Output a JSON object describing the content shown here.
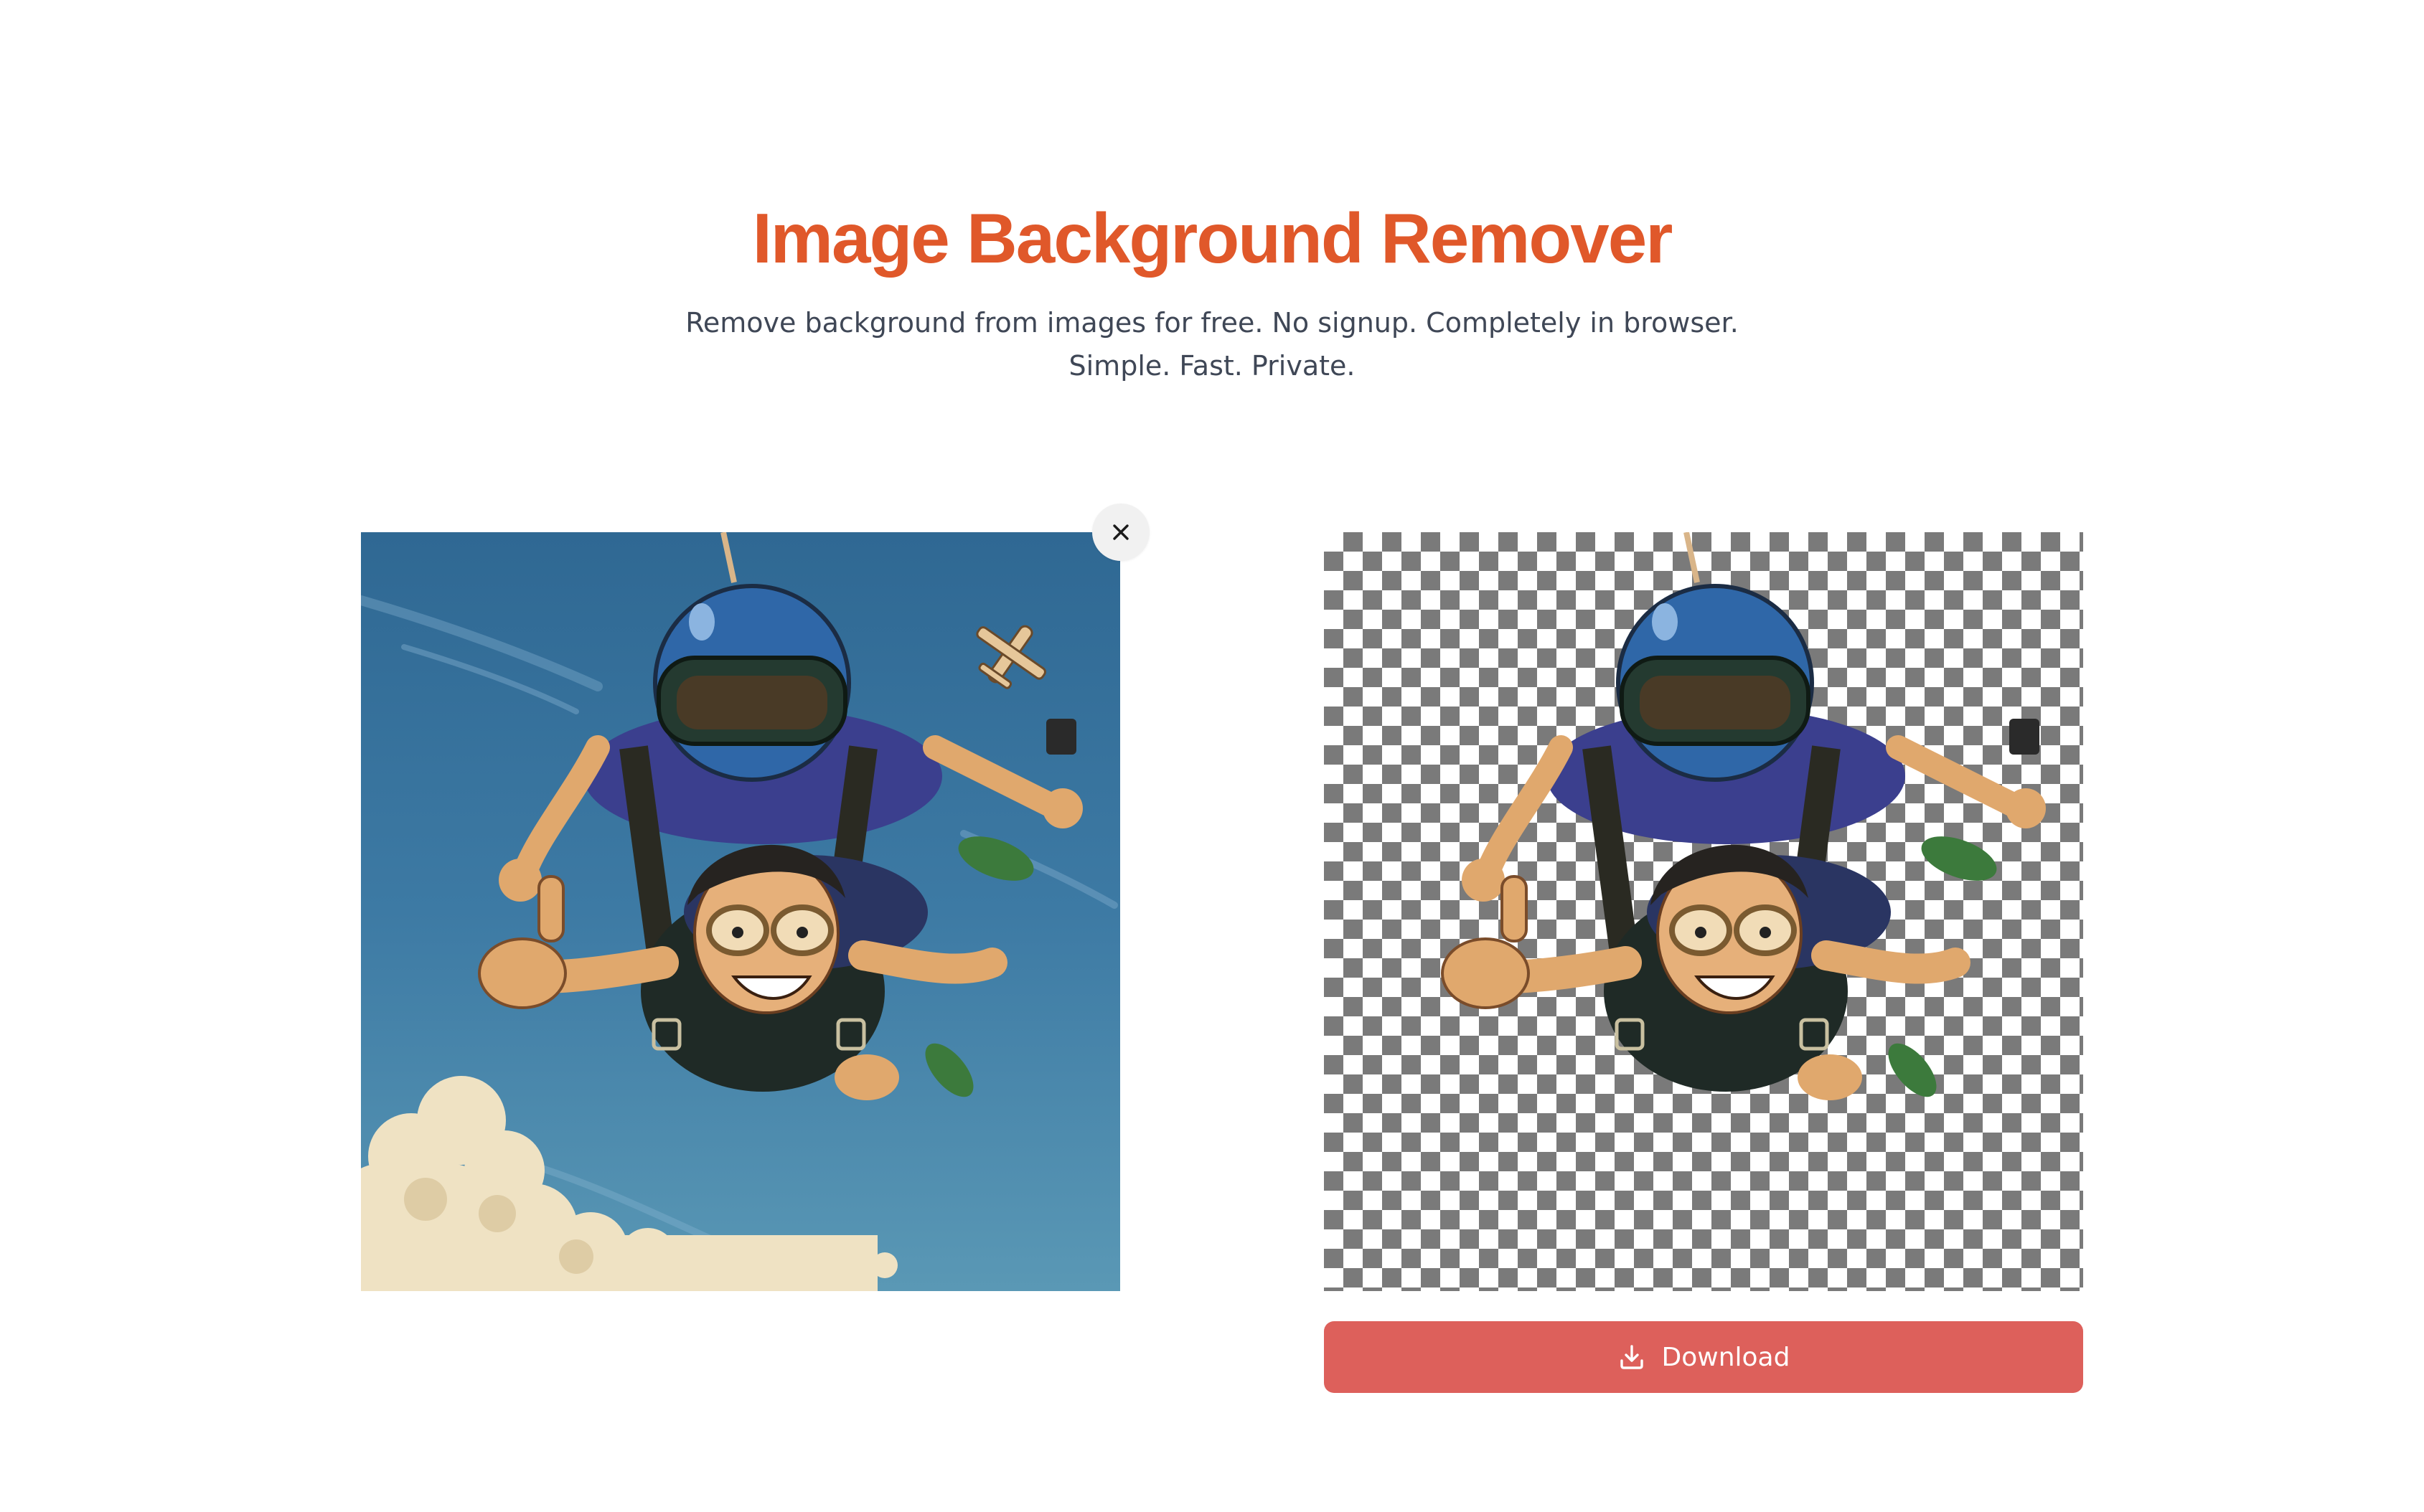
{
  "header": {
    "title": "Image Background Remover",
    "subtitle_line1": "Remove background from images for free. No signup. Completely in browser.",
    "subtitle_line2": "Simple. Fast. Private."
  },
  "original_panel": {
    "image_alt": "Cartoon illustration of tandem skydivers, the front one giving a thumbs up, against a blue sky with clouds and a small plane",
    "remove_icon": "close-icon"
  },
  "result_panel": {
    "image_alt": "Same tandem skydivers with the sky removed, shown on a transparency checkerboard"
  },
  "actions": {
    "download_label": "Download",
    "download_icon": "download-icon"
  },
  "colors": {
    "title": "#e0582a",
    "subtitle": "#3f4756",
    "download_button": "#dd605b",
    "close_button_bg": "#f1f1f1",
    "checker_dark": "#7a7a7a",
    "checker_light": "#ffffff"
  }
}
